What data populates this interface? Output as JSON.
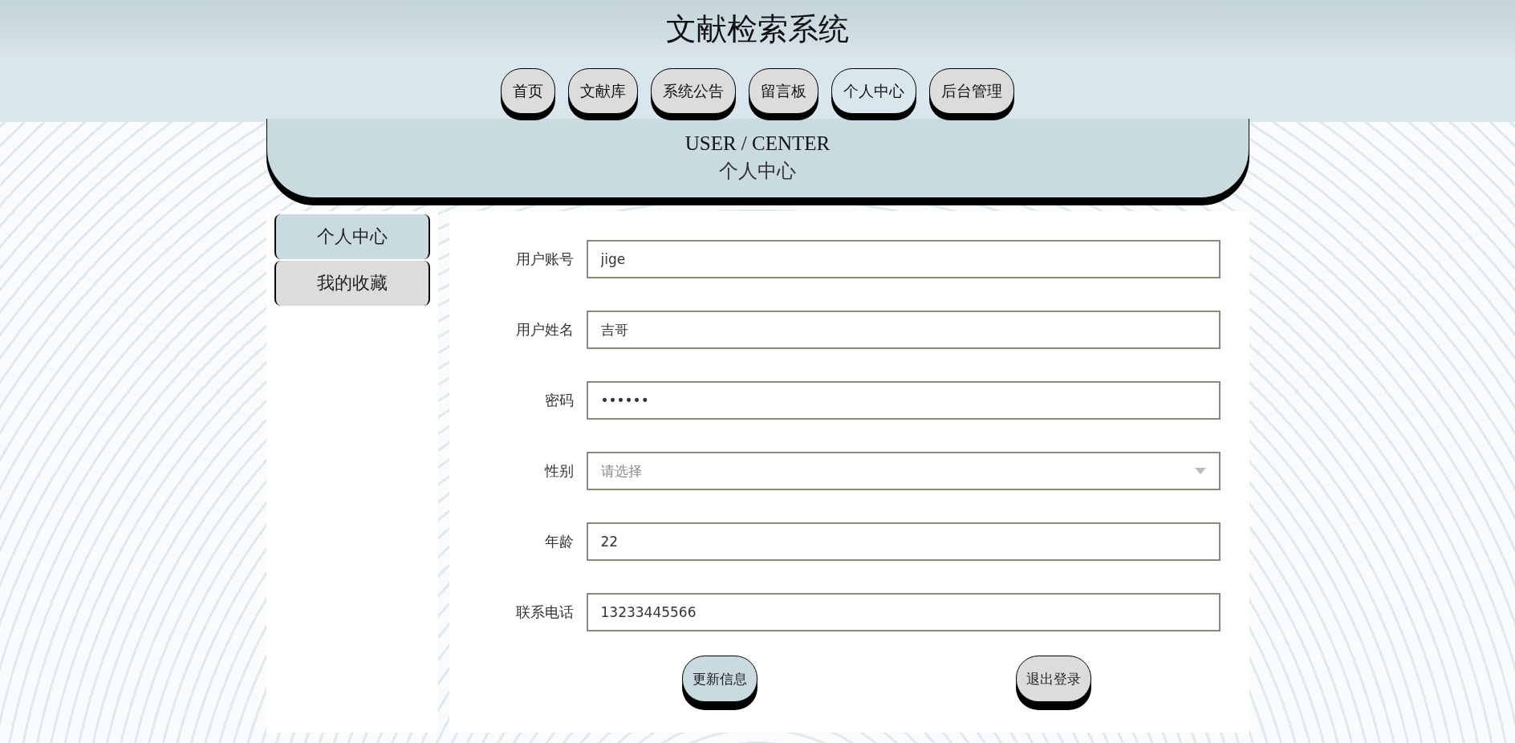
{
  "header": {
    "title": "文献检索系统"
  },
  "nav": [
    {
      "label": "首页",
      "selected": false
    },
    {
      "label": "文献库",
      "selected": false
    },
    {
      "label": "系统公告",
      "selected": false
    },
    {
      "label": "留言板",
      "selected": false
    },
    {
      "label": "个人中心",
      "selected": true
    },
    {
      "label": "后台管理",
      "selected": false
    }
  ],
  "banner": {
    "title": "USER / CENTER",
    "subtitle": "个人中心"
  },
  "sidebar": {
    "items": [
      {
        "label": "个人中心",
        "selected": true
      },
      {
        "label": "我的收藏",
        "selected": false
      }
    ]
  },
  "form": {
    "fields": [
      {
        "kind": "text",
        "label": "用户账号",
        "value": "jige"
      },
      {
        "kind": "text",
        "label": "用户姓名",
        "value": "吉哥"
      },
      {
        "kind": "text",
        "label": "密码",
        "value": "••••••"
      },
      {
        "kind": "select",
        "label": "性别",
        "placeholder": "请选择"
      },
      {
        "kind": "text",
        "label": "年龄",
        "value": "22"
      },
      {
        "kind": "text",
        "label": "联系电话",
        "value": "13233445566"
      }
    ],
    "buttons": [
      {
        "label": "更新信息",
        "kind": "primary"
      },
      {
        "label": "退出登录",
        "kind": "secondary"
      }
    ]
  }
}
